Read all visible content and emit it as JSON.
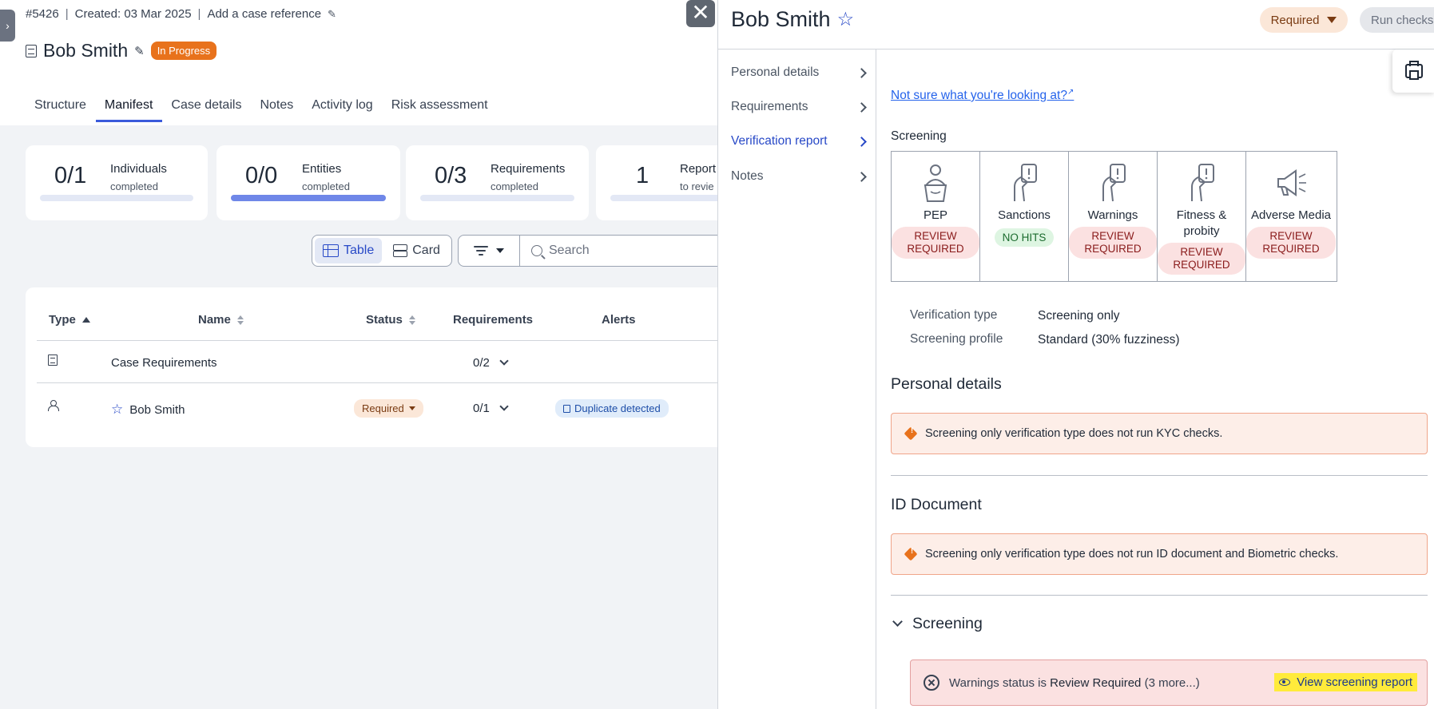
{
  "case": {
    "id": "#5426",
    "created": "Created: 03 Mar 2025",
    "add_reference": "Add a case reference",
    "name": "Bob Smith",
    "status": "In Progress"
  },
  "tabs": [
    "Structure",
    "Manifest",
    "Case details",
    "Notes",
    "Activity log",
    "Risk assessment"
  ],
  "stats": [
    {
      "num": "0/1",
      "label": "Individuals",
      "sub": "completed",
      "progress": 0
    },
    {
      "num": "0/0",
      "label": "Entities",
      "sub": "completed",
      "progress": 1
    },
    {
      "num": "0/3",
      "label": "Requirements",
      "sub": "completed",
      "progress": 0
    },
    {
      "num": "1",
      "label": "Report",
      "sub": "to revie",
      "progress": 0
    }
  ],
  "view": {
    "table": "Table",
    "card": "Card"
  },
  "search": {
    "placeholder": "Search"
  },
  "table": {
    "headers": {
      "type": "Type",
      "name": "Name",
      "status": "Status",
      "requirements": "Requirements",
      "alerts": "Alerts"
    },
    "rows": [
      {
        "name": "Case Requirements",
        "status": "",
        "requirements": "0/2",
        "alert": ""
      },
      {
        "name": "Bob Smith",
        "status": "Required",
        "requirements": "0/1",
        "alert": "Duplicate detected"
      }
    ]
  },
  "panel": {
    "title": "Bob Smith",
    "status": "Required",
    "run_checks": "Run checks",
    "nav": [
      "Personal details",
      "Requirements",
      "Verification report",
      "Notes"
    ],
    "help_link": "Not sure what you're looking at?",
    "screening_label": "Screening",
    "checks": [
      {
        "name": "PEP",
        "result": "REVIEW REQUIRED",
        "icon": "person-podium-icon"
      },
      {
        "name": "Sanctions",
        "result": "NO HITS",
        "icon": "hand-alert-icon"
      },
      {
        "name": "Warnings",
        "result": "REVIEW REQUIRED",
        "icon": "hand-alert-icon"
      },
      {
        "name": "Fitness & probity",
        "result": "REVIEW REQUIRED",
        "icon": "hand-alert-icon"
      },
      {
        "name": "Adverse Media",
        "result": "REVIEW REQUIRED",
        "icon": "megaphone-icon"
      }
    ],
    "verification_type_label": "Verification type",
    "verification_type": "Screening only",
    "screening_profile_label": "Screening profile",
    "screening_profile": "Standard (30% fuzziness)",
    "personal_details_title": "Personal details",
    "personal_details_alert": "Screening only verification type does not run KYC checks.",
    "id_document_title": "ID Document",
    "id_document_alert": "Screening only verification type does not run ID document and Biometric checks.",
    "screening_section": "Screening",
    "screening_alert_prefix": "Warnings status is",
    "screening_alert_bold": "Review Required",
    "screening_alert_more": "(3 more...)",
    "view_report": "View screening report"
  }
}
